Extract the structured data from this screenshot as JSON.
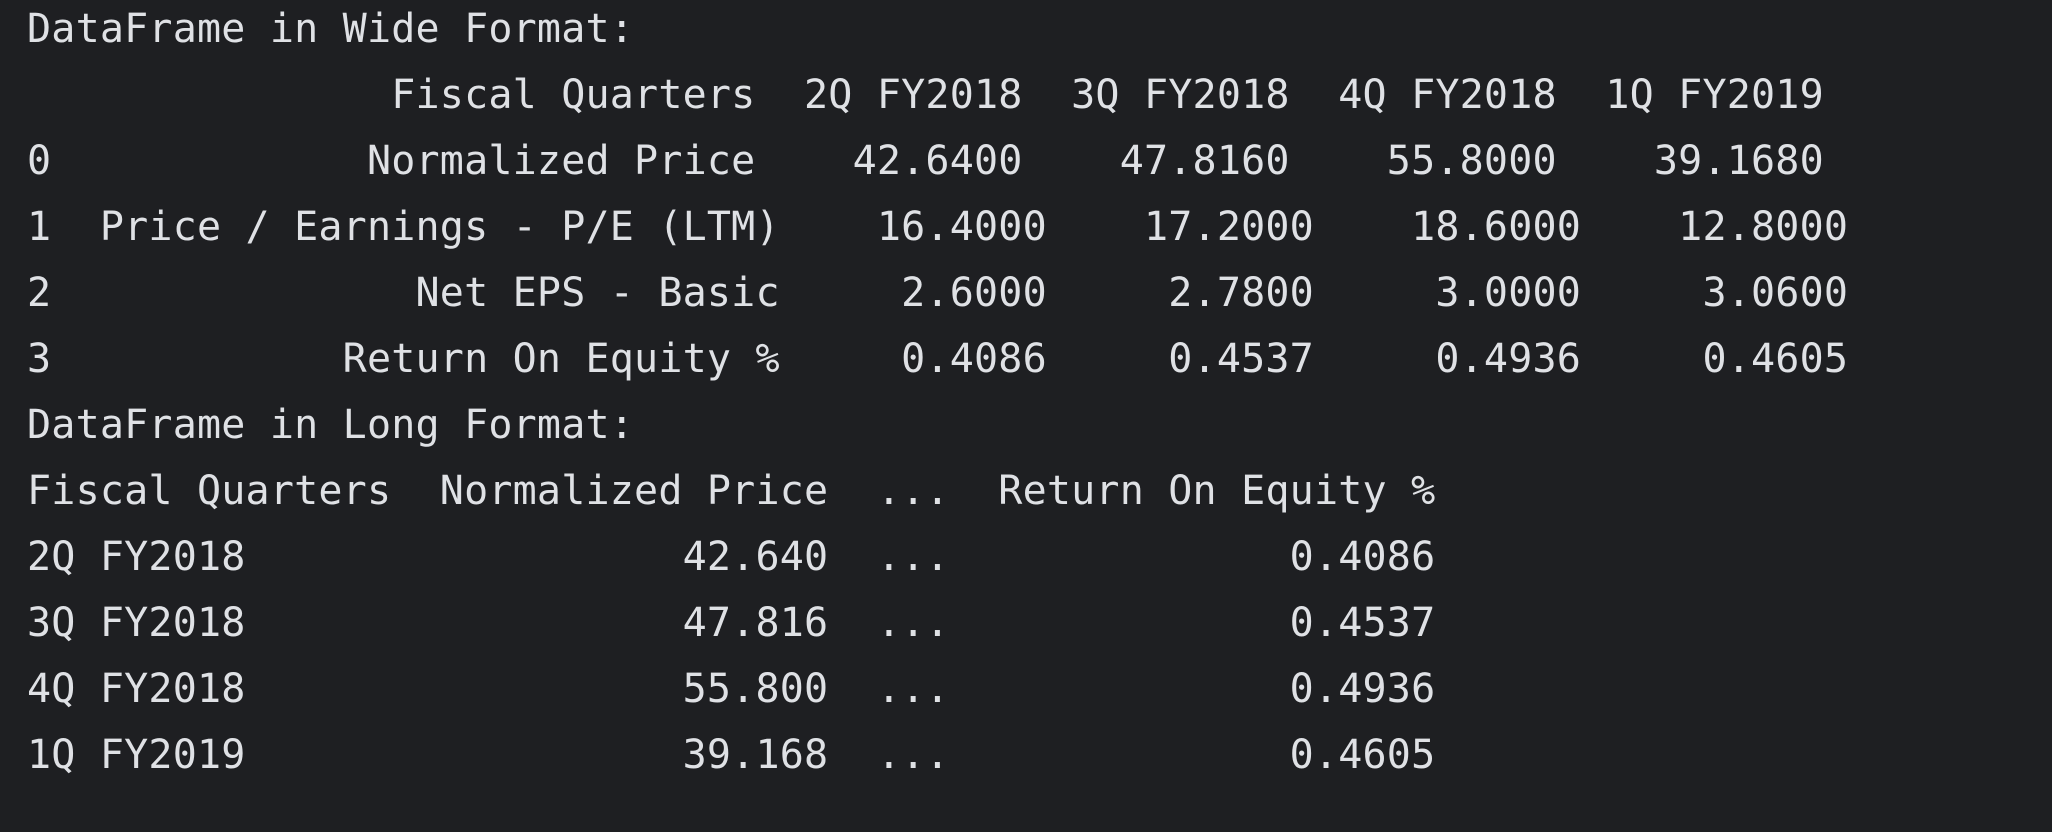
{
  "console": {
    "wide_title": "DataFrame in Wide Format:",
    "wide_header": "               Fiscal Quarters  2Q FY2018  3Q FY2018  4Q FY2018  1Q FY2019",
    "wide_rows": [
      "0             Normalized Price    42.6400    47.8160    55.8000    39.1680",
      "1  Price / Earnings - P/E (LTM)    16.4000    17.2000    18.6000    12.8000",
      "2               Net EPS - Basic     2.6000     2.7800     3.0000     3.0600",
      "3            Return On Equity %     0.4086     0.4537     0.4936     0.4605"
    ],
    "long_title": "DataFrame in Long Format:",
    "long_header": "Fiscal Quarters  Normalized Price  ...  Return On Equity %",
    "long_rows": [
      "2Q FY2018                  42.640  ...              0.4086",
      "3Q FY2018                  47.816  ...              0.4537",
      "4Q FY2018                  55.800  ...              0.4936",
      "1Q FY2019                  39.168  ...              0.4605"
    ]
  }
}
